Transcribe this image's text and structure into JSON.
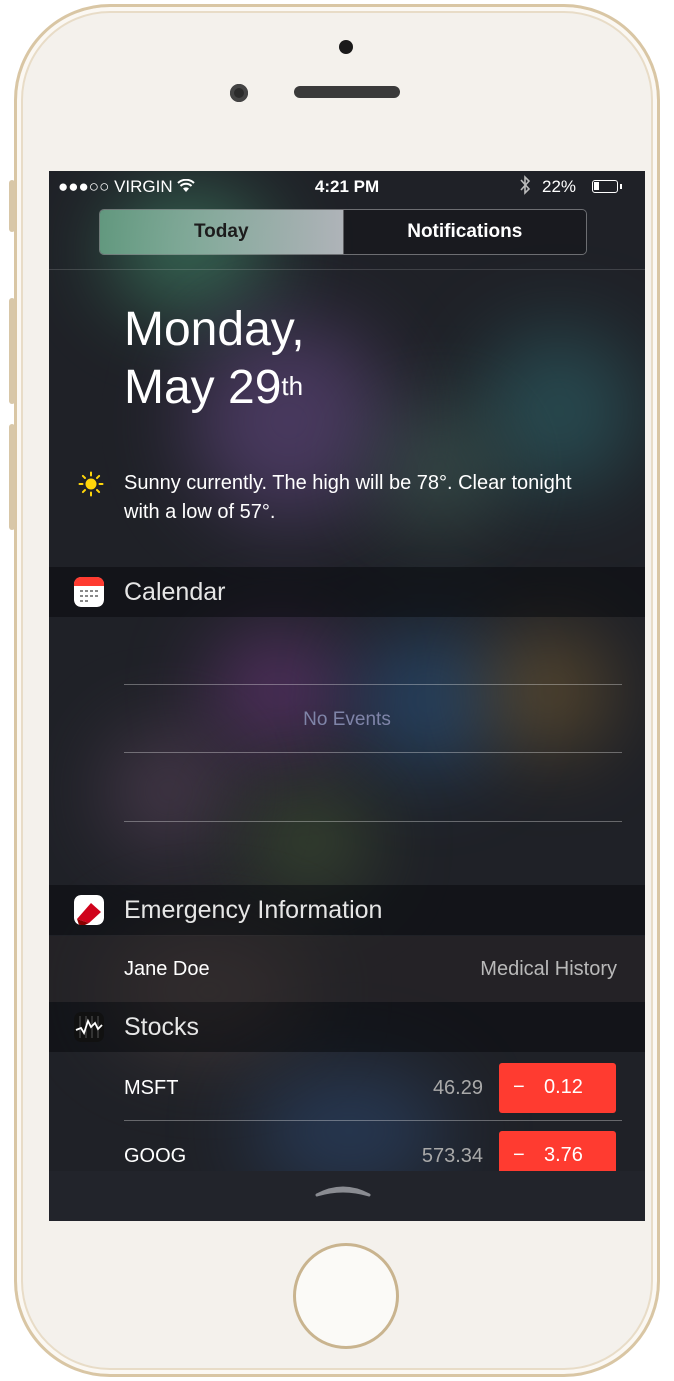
{
  "status_bar": {
    "signal": "●●●○○",
    "carrier": "VIRGIN",
    "wifi": "wifi-icon",
    "time": "4:21 PM",
    "bluetooth": "bluetooth-icon",
    "battery_percent": "22%"
  },
  "segmented_control": {
    "tabs": [
      {
        "label": "Today",
        "selected": true
      },
      {
        "label": "Notifications",
        "selected": false
      }
    ]
  },
  "today": {
    "date_line1": "Monday,",
    "date_line2_main": "May 29",
    "date_line2_suffix": "th",
    "weather_icon": "sun-icon",
    "weather_text": "Sunny currently. The high will be 78°. Clear tonight with a low of 57°."
  },
  "calendar": {
    "title": "Calendar",
    "icon": "calendar-app-icon",
    "empty_text": "No Events"
  },
  "emergency": {
    "title": "Emergency Information",
    "icon": "health-app-icon",
    "name": "Jane Doe",
    "link": "Medical History"
  },
  "stocks": {
    "title": "Stocks",
    "icon": "stocks-app-icon",
    "items": [
      {
        "symbol": "MSFT",
        "price": "46.29",
        "sign": "−",
        "change": "0.12"
      },
      {
        "symbol": "GOOG",
        "price": "573.34",
        "sign": "−",
        "change": "3.76"
      }
    ],
    "change_color": "#ff3b30"
  },
  "grabber_icon": "chevron-up-grabber-icon"
}
